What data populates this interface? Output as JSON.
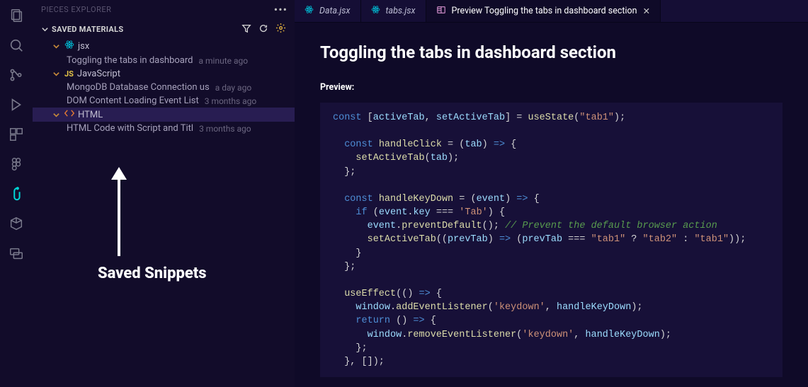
{
  "sidebar": {
    "panel_title": "PIECES EXPLORER",
    "saved_title": "SAVED MATERIALS",
    "groups": [
      {
        "label": "jsx",
        "icon": "react",
        "items": [
          {
            "name": "Toggling the tabs in dashboard",
            "time": "a minute ago"
          }
        ]
      },
      {
        "label": "JavaScript",
        "icon": "js",
        "items": [
          {
            "name": "MongoDB Database Connection us",
            "time": "a day ago"
          },
          {
            "name": "DOM Content Loading Event List",
            "time": "3 months ago"
          }
        ]
      },
      {
        "label": "HTML",
        "icon": "html",
        "items": [
          {
            "name": "HTML Code with Script and Titl",
            "time": "3 months ago"
          }
        ]
      }
    ]
  },
  "tabs": [
    {
      "label": "Data.jsx",
      "icon": "react"
    },
    {
      "label": "tabs.jsx",
      "icon": "react"
    },
    {
      "label": "Preview Toggling the tabs in dashboard section",
      "icon": "preview",
      "active": true,
      "closable": true
    }
  ],
  "annotation": "Saved Snippets",
  "content": {
    "title": "Toggling the tabs in dashboard section",
    "preview_label": "Preview:",
    "code": {
      "l1a": "const",
      "l1b": " [",
      "l1c": "activeTab",
      "l1d": ", ",
      "l1e": "setActiveTab",
      "l1f": "] = ",
      "l1g": "useState",
      "l1h": "(",
      "l1i": "\"tab1\"",
      "l1j": ");",
      "l3a": "  const",
      "l3b": " ",
      "l3c": "handleClick",
      "l3d": " = (",
      "l3e": "tab",
      "l3f": ") ",
      "l3g": "=>",
      "l3h": " {",
      "l4a": "    ",
      "l4b": "setActiveTab",
      "l4c": "(",
      "l4d": "tab",
      "l4e": ");",
      "l5": "  };",
      "l7a": "  const",
      "l7b": " ",
      "l7c": "handleKeyDown",
      "l7d": " = (",
      "l7e": "event",
      "l7f": ") ",
      "l7g": "=>",
      "l7h": " {",
      "l8a": "    if",
      "l8b": " (",
      "l8c": "event",
      "l8d": ".",
      "l8e": "key",
      "l8f": " === ",
      "l8g": "'Tab'",
      "l8h": ") {",
      "l9a": "      ",
      "l9b": "event",
      "l9c": ".",
      "l9d": "preventDefault",
      "l9e": "(); ",
      "l9f": "// Prevent the default browser action",
      "l10a": "      ",
      "l10b": "setActiveTab",
      "l10c": "((",
      "l10d": "prevTab",
      "l10e": ") ",
      "l10f": "=>",
      "l10g": " (",
      "l10h": "prevTab",
      "l10i": " === ",
      "l10j": "\"tab1\"",
      "l10k": " ? ",
      "l10l": "\"tab2\"",
      "l10m": " : ",
      "l10n": "\"tab1\"",
      "l10o": "));",
      "l11": "    }",
      "l12": "  };",
      "l14a": "  ",
      "l14b": "useEffect",
      "l14c": "(() ",
      "l14d": "=>",
      "l14e": " {",
      "l15a": "    ",
      "l15b": "window",
      "l15c": ".",
      "l15d": "addEventListener",
      "l15e": "(",
      "l15f": "'keydown'",
      "l15g": ", ",
      "l15h": "handleKeyDown",
      "l15i": ");",
      "l16a": "    return",
      "l16b": " () ",
      "l16c": "=>",
      "l16d": " {",
      "l17a": "      ",
      "l17b": "window",
      "l17c": ".",
      "l17d": "removeEventListener",
      "l17e": "(",
      "l17f": "'keydown'",
      "l17g": ", ",
      "l17h": "handleKeyDown",
      "l17i": ");",
      "l18": "    };",
      "l19": "  }, []);"
    }
  }
}
